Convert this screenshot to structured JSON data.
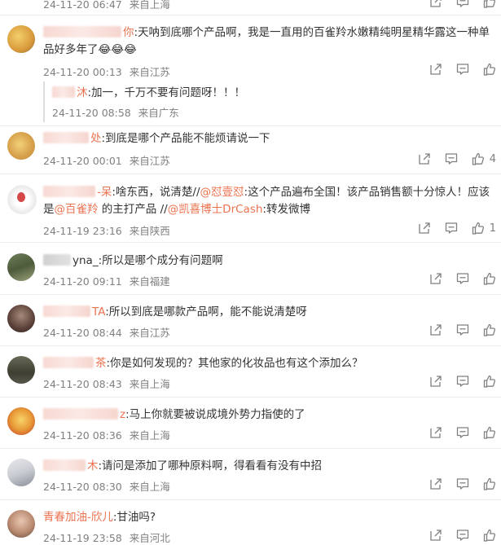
{
  "comments": [
    {
      "name": "",
      "text": "",
      "time": "24-11-20 06:47",
      "location": "来自上海"
    },
    {
      "name": "你",
      "text": ":天呐到底哪个产品啊，我是一直用的百雀羚水嫩精纯明星精华露这一种单品好多年了😂😂😂",
      "time": "24-11-20 00:13",
      "location": "来自江苏",
      "reply": {
        "name": "沐",
        "text": ":加一，千万不要有问题呀！！！",
        "time": "24-11-20 08:58",
        "location": "来自广东"
      }
    },
    {
      "name": "处",
      "text": ":到底是哪个产品能不能烦请说一下",
      "time": "24-11-20 00:01",
      "location": "来自江苏",
      "likes": "4"
    },
    {
      "name": "-呆",
      "text_parts": [
        ":啥东西，说清楚//",
        "@怼壹怼",
        ":这个产品遍布全国！该产品销售额十分惊人！应该是",
        "@百雀羚",
        " 的主打产品 //",
        "@凯喜博士DrCash",
        ":转发微博"
      ],
      "time": "24-11-19 23:16",
      "location": "来自陕西",
      "likes": "1"
    },
    {
      "name": "yna_",
      "text": ":所以是哪个成分有问题啊",
      "time": "24-11-20 09:11",
      "location": "来自福建"
    },
    {
      "name": "TA",
      "text": ":所以到底是哪款产品啊，能不能说清楚呀",
      "time": "24-11-20 08:44",
      "location": "来自江苏"
    },
    {
      "name": "茶",
      "text": ":你是如何发现的？其他家的化妆品也有这个添加么？",
      "time": "24-11-20 08:43",
      "location": "来自上海"
    },
    {
      "name": "z",
      "text": ":马上你就要被说成境外势力指使的了",
      "time": "24-11-20 08:36",
      "location": "来自上海"
    },
    {
      "name": "木",
      "text": ":请问是添加了哪种原料啊，得看看有没有中招",
      "time": "24-11-20 08:30",
      "location": "来自上海"
    },
    {
      "name": "青春加油-欣儿",
      "text": ":甘油吗?",
      "time": "24-11-19 23:58",
      "location": "来自河北"
    }
  ],
  "icons": [
    "share-icon",
    "comment-icon",
    "like-icon"
  ],
  "colors": {
    "accent": "#eb7350",
    "meta": "#808080"
  }
}
